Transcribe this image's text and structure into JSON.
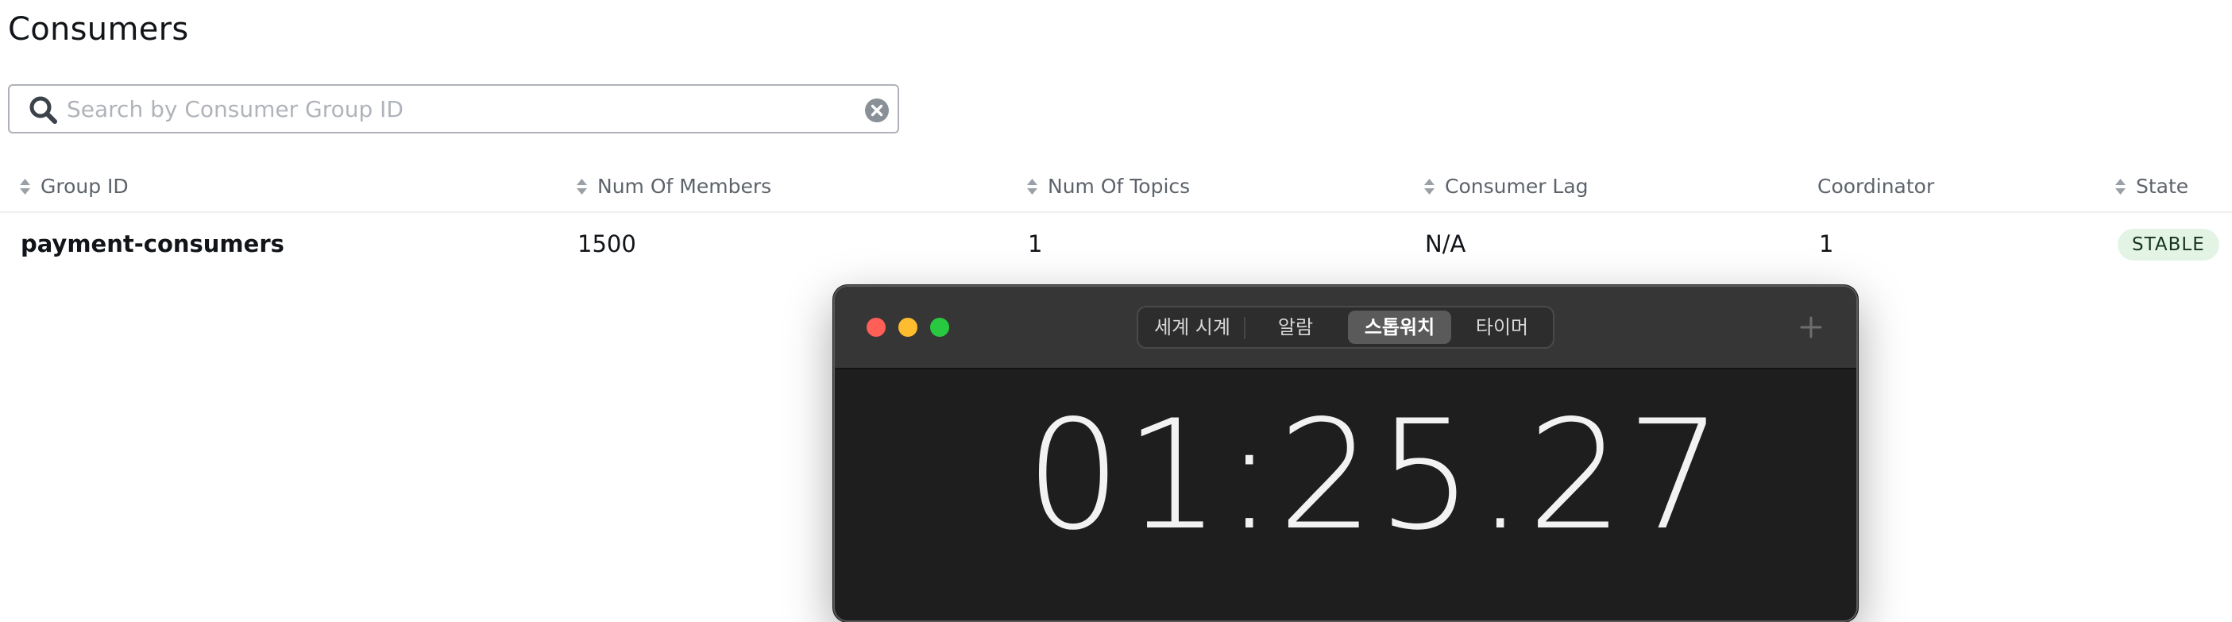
{
  "page": {
    "title": "Consumers"
  },
  "search": {
    "placeholder": "Search by Consumer Group ID",
    "value": ""
  },
  "table": {
    "columns": [
      {
        "label": "Group ID",
        "sortable": true
      },
      {
        "label": "Num Of Members",
        "sortable": true
      },
      {
        "label": "Num Of Topics",
        "sortable": true
      },
      {
        "label": "Consumer Lag",
        "sortable": true
      },
      {
        "label": "Coordinator",
        "sortable": false
      },
      {
        "label": "State",
        "sortable": true
      }
    ],
    "rows": [
      {
        "group_id": "payment-consumers",
        "num_members": "1500",
        "num_topics": "1",
        "consumer_lag": "N/A",
        "coordinator": "1",
        "state": "STABLE"
      }
    ]
  },
  "clock_app": {
    "tabs": [
      "세계 시계",
      "알람",
      "스톱워치",
      "타이머"
    ],
    "active_tab": "스톱워치",
    "stopwatch_time": "01:25.27"
  },
  "colors": {
    "stable_badge_bg": "#e3f4e5",
    "traffic_close": "#ff5f57",
    "traffic_minimize": "#febc2e",
    "traffic_maximize": "#28c840",
    "clock_bg": "#1e1e1e"
  },
  "icons": {
    "search": "search-icon",
    "clear": "clear-icon",
    "sort": "sort-icon",
    "add": "plus-icon"
  }
}
